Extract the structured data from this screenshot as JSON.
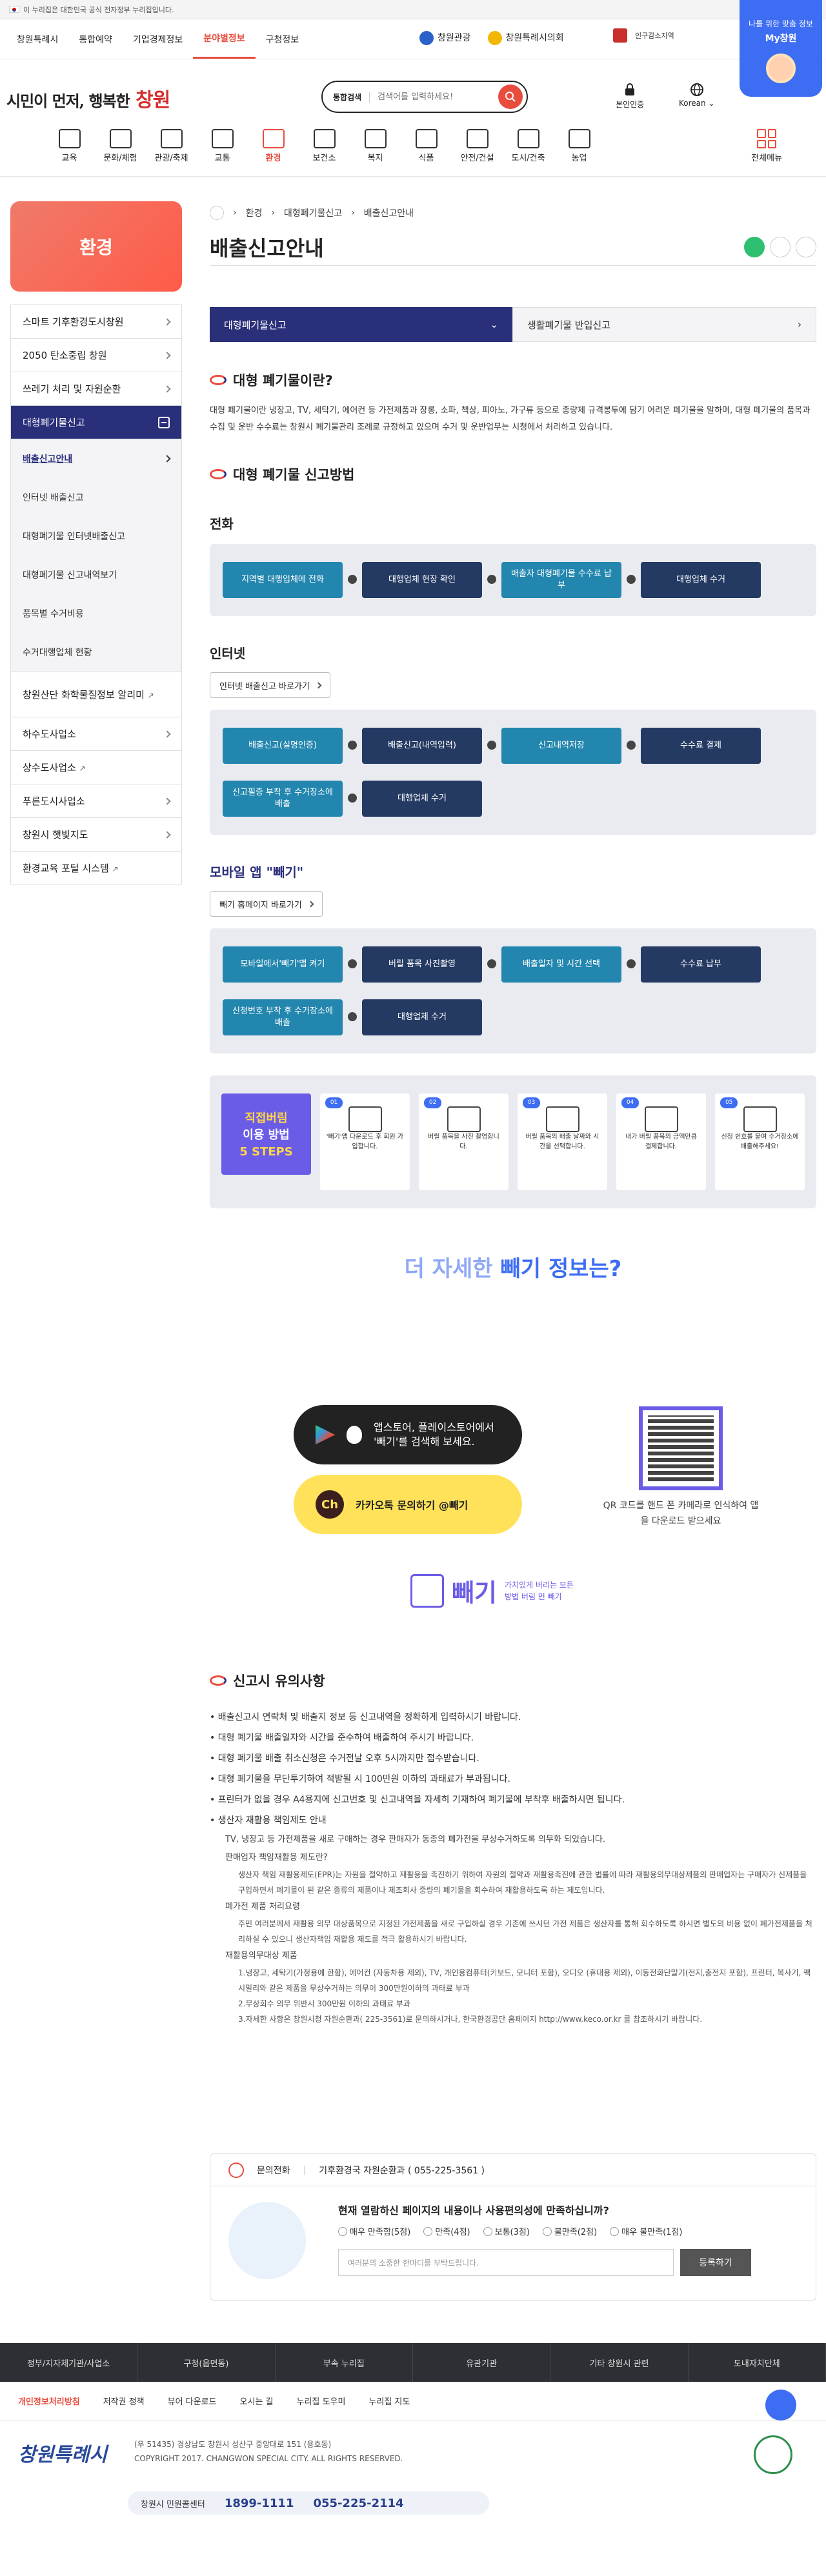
{
  "gov_bar": {
    "text": "이 누리집은 대한민국 공식 전자정부 누리집입니다."
  },
  "sites": [
    {
      "label": "창원특례시"
    },
    {
      "label": "통합예약"
    },
    {
      "label": "기업경제정보"
    },
    {
      "label": "분야별정보",
      "active": true
    },
    {
      "label": "구청정보"
    }
  ],
  "top_links": {
    "tour": "창원관광",
    "special": "창원특례시의회"
  },
  "gov_logo": "인구감소지역",
  "promo": {
    "line1": "나를 위한 맞춤 정보",
    "line2": "My창원"
  },
  "logo": {
    "text1": "시민이 먼저, 행복한",
    "text2": "창원"
  },
  "search": {
    "category": "통합검색",
    "placeholder": "검색어를 입력하세요!"
  },
  "header_icons": {
    "auth": "본인인증",
    "lang": "Korean"
  },
  "menu": [
    {
      "label": "교육"
    },
    {
      "label": "문화/체험"
    },
    {
      "label": "관광/축제"
    },
    {
      "label": "교통"
    },
    {
      "label": "환경",
      "active": true
    },
    {
      "label": "보건소"
    },
    {
      "label": "복지"
    },
    {
      "label": "식품"
    },
    {
      "label": "안전/건설"
    },
    {
      "label": "도시/건축"
    },
    {
      "label": "농업"
    }
  ],
  "menu_all": "전체메뉴",
  "sidebar": {
    "title": "환경",
    "items": [
      {
        "label": "스마트 기후환경도시창원"
      },
      {
        "label": "2050 탄소중립 창원"
      },
      {
        "label": "쓰레기 처리 및 자원순환"
      },
      {
        "label": "대형폐기물신고",
        "active": true
      }
    ],
    "sub": [
      {
        "label": "배출신고안내",
        "active": true
      },
      {
        "label": "인터넷 배출신고"
      },
      {
        "label": "대형폐기물 인터넷배출신고"
      },
      {
        "label": "대형폐기물 신고내역보기"
      },
      {
        "label": "품목별 수거비용"
      },
      {
        "label": "수거대행업체 현황"
      }
    ],
    "items2": [
      {
        "label": "창원산단 화학물질정보 알리미",
        "ext": "↗"
      },
      {
        "label": "하수도사업소"
      },
      {
        "label": "상수도사업소",
        "ext": "↗"
      },
      {
        "label": "푸른도시사업소"
      },
      {
        "label": "창원시 햇빛지도"
      },
      {
        "label": "환경교육 포털 시스템",
        "ext": "↗"
      }
    ]
  },
  "breadcrumb": [
    "환경",
    "대형폐기물신고",
    "배출신고안내"
  ],
  "page_title": "배출신고안내",
  "tabs": [
    {
      "label": "대형폐기물신고"
    },
    {
      "label": "생활폐기물 반입신고"
    }
  ],
  "section1": {
    "title": "대형 폐기물이란?",
    "text": "대형 폐기물이란 냉장고, TV, 세탁기, 에어컨 등 가전제품과 장롱, 소파, 책상, 피아노, 가구류 등으로 종량제 규격봉투에 담기 어려운 폐기물을 말하며, 대형 폐기물의 품목과 수집 및 운반 수수료는 창원시 폐기물관리 조례로 규정하고 있으며 수거 및 운반업무는 시청에서 처리하고 있습니다."
  },
  "section2": {
    "title": "대형 폐기물 신고방법",
    "phone": {
      "title": "전화",
      "steps": [
        "지역별 대행업체에 전화",
        "대행업체 현장 확인",
        "배출자 대형폐기물 수수료 납부",
        "대행업체 수거"
      ]
    },
    "internet": {
      "title": "인터넷",
      "link": "인터넷 배출신고 바로가기",
      "steps": [
        "배출신고(실명인증)",
        "배출신고(내역입력)",
        "신고내역저장",
        "수수료 결제",
        "신고필증 부착 후 수거장소에 배출",
        "대행업체 수거"
      ]
    },
    "app": {
      "title": "모바일 앱 \"빼기\"",
      "link": "빼기 홈페이지 바로가기",
      "steps": [
        "모바일에서'빼기'앱 켜기",
        "버릴 품목 사진촬영",
        "배출일자 및 시간 선택",
        "수수료 납부",
        "신청번호 부착 후 수거장소에 배출",
        "대행업체 수거"
      ]
    }
  },
  "five_steps": {
    "lead1": "직접버림",
    "lead2": "이용 방법",
    "lead3": "5 STEPS",
    "cards": [
      {
        "num": "01",
        "text": "'빼기'앱 다운로드 후 회원 가입합니다."
      },
      {
        "num": "02",
        "text": "버릴 품목을 사진 촬영합니다."
      },
      {
        "num": "03",
        "text": "버릴 품목의 배출 날짜와 시간을 선택합니다."
      },
      {
        "num": "04",
        "text": "내가 버릴 품목의 금액만큼 결제합니다."
      },
      {
        "num": "05",
        "text": "신청 번호를 붙여 수거장소에 배출해주세요!"
      }
    ]
  },
  "more_info": {
    "title_pre": "더 자세한",
    "title_bold": "빼기 정보는?",
    "store_text": "앱스토어, 플레이스토어에서 '빼기'를 검색해 보세요.",
    "kakao_text": "카카오톡 문의하기 @빼기",
    "qr_caption": "QR 코드를 핸드 폰 카메라로 인식하여 앱을 다운로드 받으세요",
    "brand": "빼기",
    "brand_sub": "가치있게 버리는 모든 방법 버림 먼 빼기"
  },
  "notice": {
    "title": "신고시 유의사항",
    "items": [
      "배출신고시 연락처 및 배출지 정보 등 신고내역을 정확하게 입력하시기 바랍니다.",
      "대형 폐기물 배출일자와 시간을 준수하여 배출하여 주시기 바랍니다.",
      "대형 폐기물 배출 취소신청은 수거전날 오후 5시까지만 접수받습니다.",
      "대형 폐기물을 무단투기하여 적발될 시 100만원 이하의 과태료가 부과됩니다.",
      "프린터가 없을 경우 A4용지에 신고번호 및 신고내역을 자세히 기재하여 폐기물에 부착후 배출하시면 됩니다.",
      "생산자 재활용 책임제도 안내"
    ],
    "sub": [
      "TV, 냉장고 등 가전제품을 새로 구매하는 경우 판매자가 동종의 폐가전을 무상수거하도록 의무화 되었습니다.",
      "판매업자 책임재활용 제도란?",
      "생산자 책임 재활용제도(EPR)는 자원을 절약하고 재활용을 촉진하기 위하여 자원의 절약과 재활용촉진에 관한 법률에 따라 재활용의무대상제품의 판매업자는 구매자가 신제품을 구입하면서 폐기물이 된 같은 종류의 제품이나 제조회사 중량의 폐기물을 회수하여 재활용하도록 하는 제도입니다.",
      "폐가전 제품 처리요령",
      "주민 여러분께서 재활용 의무 대상품목으로 지정된 가전제품을 새로 구입하실 경우 기존에 쓰시던 가전 제품은 생산자를 통해 회수하도록 하시면 별도의 비용 없이 폐가전제품을 처리하실 수 있으니 생산자책임 재활용 제도를 적극 활용하시기 바랍니다.",
      "재활용의무대상 제품",
      "1.냉장고, 세탁기(가정용에 한함), 에어컨 (자동차용 제외), TV, 개인용컴퓨터(키보드, 모니터 포함), 오디오 (휴대용 제외), 이동전화단말기(전지,충전지 포함), 프린터, 복사기, 팩시밀리와 같은 제품을 무상수거하는 의무이 300만원이하의 과태료 부과",
      "2.무상회수 의무 위반시 300만원 이하의 과태료 부과",
      "3.자세한 사항은 창원시청 자원순환과( 225-3561)로 문의하시거나, 한국환경공단 홈페이지 http://www.keco.or.kr 를 참조하시기 바랍니다."
    ]
  },
  "rating": {
    "contact_label": "문의전화",
    "contact": "기후환경국 자원순환과 ( 055-225-3561 )",
    "question": "현재 열람하신 페이지의 내용이나 사용편의성에 만족하십니까?",
    "options": [
      "매우 만족함(5점)",
      "만족(4점)",
      "보통(3점)",
      "불만족(2점)",
      "매우 불만족(1점)"
    ],
    "placeholder": "여러분의 소중한 한마디를 부탁드립니다.",
    "submit": "등록하기"
  },
  "footer_links": [
    "정부/지자체기관/사업소",
    "구청(읍면동)",
    "부속 누리집",
    "유관기관",
    "기타 창원시 관련",
    "도내자치단체"
  ],
  "footer_policy": [
    "개인정보처리방침",
    "저작권 정책",
    "뷰어 다운로드",
    "오시는 길",
    "누리집 도우미",
    "누리집 지도"
  ],
  "footer": {
    "logo": "창원특례시",
    "addr1": "(우 51435) 경상남도 창원시 성산구 중앙대로 151 (용호동)",
    "addr2": "COPYRIGHT 2017. CHANGWON SPECIAL CITY. ALL RIGHTS RESERVED.",
    "center": "창원시 민원콜센터",
    "phone1": "1899-1111",
    "phone2": "055-225-2114"
  }
}
